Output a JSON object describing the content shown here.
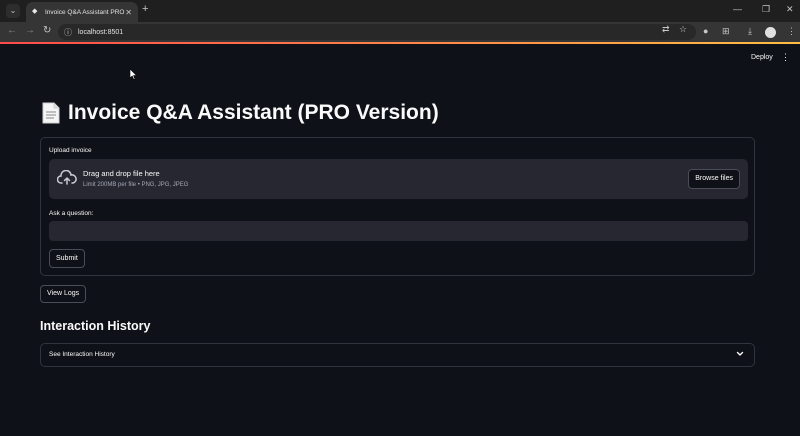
{
  "browser": {
    "tab_title": "Invoice Q&A Assistant PRO",
    "url": "localhost:8501"
  },
  "header": {
    "deploy_label": "Deploy"
  },
  "main": {
    "title": "Invoice Q&A Assistant (PRO Version)",
    "upload": {
      "label": "Upload invoice",
      "dropzone_text": "Drag and drop file here",
      "dropzone_hint": "Limit 200MB per file • PNG, JPG, JPEG",
      "browse_label": "Browse files"
    },
    "question": {
      "label": "Ask a question:",
      "value": "",
      "placeholder": ""
    },
    "submit_label": "Submit",
    "view_logs_label": "View Logs",
    "history": {
      "title": "Interaction History",
      "expander_label": "See Interaction History"
    }
  },
  "colors": {
    "background": "#0e1117",
    "widget_bg": "#262730",
    "accent_gradient_start": "#ff4b4b",
    "accent_gradient_end": "#ffbd45"
  },
  "icons": {
    "title_icon": "document-icon",
    "upload_icon": "cloud-upload-icon"
  }
}
